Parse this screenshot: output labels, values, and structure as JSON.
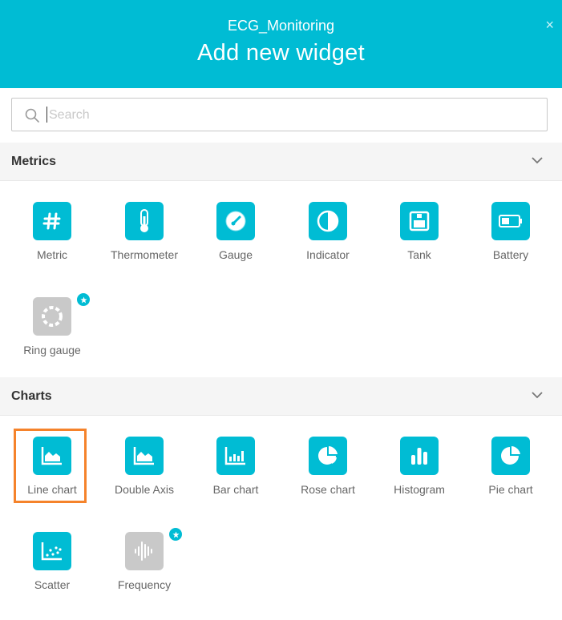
{
  "header": {
    "subtitle": "ECG_Monitoring",
    "title": "Add new widget",
    "close": "×"
  },
  "search": {
    "placeholder": "Search",
    "value": ""
  },
  "sections": {
    "metrics": {
      "label": "Metrics",
      "items": [
        {
          "label": "Metric",
          "icon": "hash-icon"
        },
        {
          "label": "Thermometer",
          "icon": "thermometer-icon"
        },
        {
          "label": "Gauge",
          "icon": "gauge-icon"
        },
        {
          "label": "Indicator",
          "icon": "indicator-icon"
        },
        {
          "label": "Tank",
          "icon": "tank-icon"
        },
        {
          "label": "Battery",
          "icon": "battery-icon"
        },
        {
          "label": "Ring gauge",
          "icon": "ring-gauge-icon",
          "premium": true
        }
      ]
    },
    "charts": {
      "label": "Charts",
      "items": [
        {
          "label": "Line chart",
          "icon": "area-chart-icon",
          "selected": true
        },
        {
          "label": "Double Axis",
          "icon": "area-chart-icon"
        },
        {
          "label": "Bar chart",
          "icon": "bar-chart-icon"
        },
        {
          "label": "Rose chart",
          "icon": "rose-chart-icon"
        },
        {
          "label": "Histogram",
          "icon": "histogram-icon"
        },
        {
          "label": "Pie chart",
          "icon": "pie-chart-icon"
        },
        {
          "label": "Scatter",
          "icon": "scatter-icon"
        },
        {
          "label": "Frequency",
          "icon": "frequency-icon",
          "premium": true
        }
      ]
    }
  },
  "colors": {
    "accent": "#00BCD4",
    "highlight": "#F5832B",
    "disabled_tile": "#C9C9C9"
  }
}
